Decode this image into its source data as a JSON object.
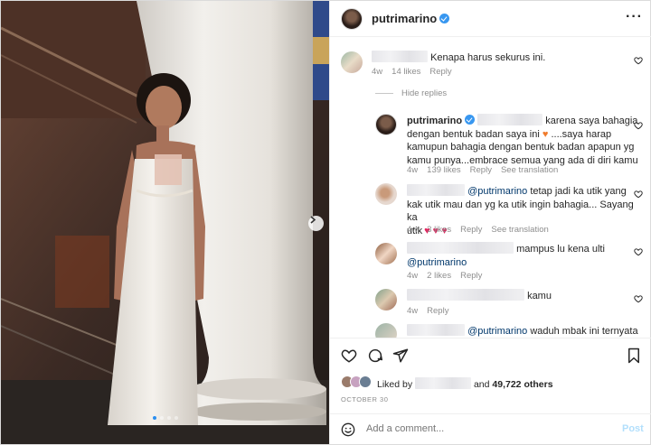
{
  "post": {
    "username": "putrimarino",
    "carousel_dots": 4,
    "carousel_active": 0
  },
  "comments": [
    {
      "text": "Kenapa harus sekurus ini.",
      "time": "4w",
      "likes": "14 likes",
      "reply": "Reply"
    },
    {
      "hide_replies": "Hide replies"
    },
    {
      "user": "putrimarino",
      "line1": "karena saya bahagia",
      "line2": "dengan bentuk badan saya ini",
      "line2b": "....saya harap",
      "line3": "kamupun bahagia dengan bentuk badan apapun yg",
      "line4": "kamu punya...embrace semua yang ada di diri kamu",
      "time": "4w",
      "likes": "139 likes",
      "reply": "Reply",
      "translate": "See translation"
    },
    {
      "mention": "@putrimarino",
      "line1": "tetap jadi ka utik yang",
      "line2": "kak utik mau dan yg ka utik ingin bahagia... Sayang ka",
      "line3": "utik",
      "time": "4w",
      "likes": "3 likes",
      "reply": "Reply",
      "translate": "See translation"
    },
    {
      "line1": "mampus lu kena ulti",
      "mention": "@putrimarino",
      "time": "4w",
      "likes": "2 likes",
      "reply": "Reply"
    },
    {
      "line1": "kamu",
      "time": "4w",
      "reply": "Reply"
    },
    {
      "mention": "@putrimarino",
      "line1": "waduh mbak ini ternyata"
    }
  ],
  "likes": {
    "liked_by": "Liked by",
    "and": "and",
    "count": "49,722 others"
  },
  "date": "OCTOBER 30",
  "add_comment": {
    "placeholder": "Add a comment...",
    "post": "Post"
  },
  "colors": {
    "verified": "#3897f0",
    "mention": "#00376b",
    "heart_red": "#e0245e",
    "post_disabled": "#b2dffc",
    "muted": "#8e8e8e"
  }
}
